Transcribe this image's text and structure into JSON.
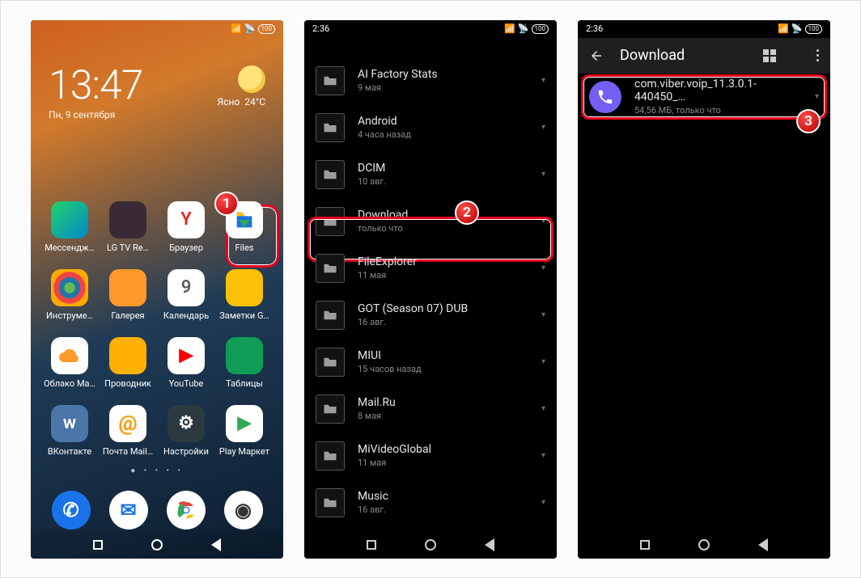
{
  "screen1": {
    "time": "13:47",
    "date": "Пн, 9 сентября",
    "weather_label": "Ясно",
    "weather_temp": "24°C",
    "status_battery": "100",
    "apps": [
      {
        "id": "messengers",
        "label": "Мессендж…",
        "bg": "#1f7ba0"
      },
      {
        "id": "lgtvremote",
        "label": "LG TV Re…",
        "bg": "#3a2a36"
      },
      {
        "id": "browser",
        "label": "Браузер",
        "bg": "#ffffff",
        "glyph": "Y",
        "glyphColor": "#e52620"
      },
      {
        "id": "files",
        "label": "Files",
        "bg": "#ffffff"
      },
      {
        "id": "tools",
        "label": "Инструме…",
        "bg": "#3a3648"
      },
      {
        "id": "gallery",
        "label": "Галерея",
        "bg": "#ff9a2a"
      },
      {
        "id": "calendar",
        "label": "Календарь",
        "bg": "#ffffff",
        "glyph": "9",
        "glyphColor": "#5c5c5c"
      },
      {
        "id": "notes",
        "label": "Заметки G…",
        "bg": "#ffc107"
      },
      {
        "id": "cloudmail",
        "label": "Облако Ма…",
        "bg": "#ffffff"
      },
      {
        "id": "explorer",
        "label": "Проводник",
        "bg": "#ffb000"
      },
      {
        "id": "youtube",
        "label": "YouTube",
        "bg": "#ffffff",
        "glyph": "▶",
        "glyphColor": "#ff0000"
      },
      {
        "id": "sheets",
        "label": "Таблицы",
        "bg": "#0f9d58"
      },
      {
        "id": "vk",
        "label": "ВКонтакте",
        "bg": "#4a76a8",
        "glyph": "w"
      },
      {
        "id": "mail",
        "label": "Почта Mail…",
        "bg": "#ffffff"
      },
      {
        "id": "settings",
        "label": "Настройки",
        "bg": "#2a3a40",
        "glyph": "⚙"
      },
      {
        "id": "playmarket",
        "label": "Play Маркет",
        "bg": "#ffffff",
        "glyph": "▶",
        "glyphColor": "#34a853"
      }
    ],
    "dock": [
      {
        "id": "phone",
        "bg": "#1a73e8",
        "glyph": "✆"
      },
      {
        "id": "messages",
        "bg": "#ffffff",
        "glyph": "✉",
        "glyphColor": "#1a73e8"
      },
      {
        "id": "chrome",
        "bg": "#ffffff"
      },
      {
        "id": "camera",
        "bg": "#ffffff",
        "glyph": "◉",
        "glyphColor": "#333"
      }
    ]
  },
  "screen2": {
    "clock": "2:36",
    "status_battery": "100",
    "folders": [
      {
        "name": "AI Factory Stats",
        "sub": "9 мая"
      },
      {
        "name": "Android",
        "sub": "4 часа назад"
      },
      {
        "name": "DCIM",
        "sub": "10 авг."
      },
      {
        "name": "Download",
        "sub": "только что",
        "highlighted": true
      },
      {
        "name": "FileExplorer",
        "sub": "11 мая"
      },
      {
        "name": "GOT (Season 07) DUB",
        "sub": "16 авг."
      },
      {
        "name": "MIUI",
        "sub": "15 часов назад"
      },
      {
        "name": "Mail.Ru",
        "sub": "8 мая"
      },
      {
        "name": "MiVideoGlobal",
        "sub": "11 мая"
      },
      {
        "name": "Music",
        "sub": "16 авг."
      }
    ]
  },
  "screen3": {
    "clock": "2:36",
    "status_battery": "100",
    "title": "Download",
    "file": {
      "name": "com.viber.voip_11.3.0.1-440450_…",
      "sub": "54,56 МБ, только что"
    }
  }
}
